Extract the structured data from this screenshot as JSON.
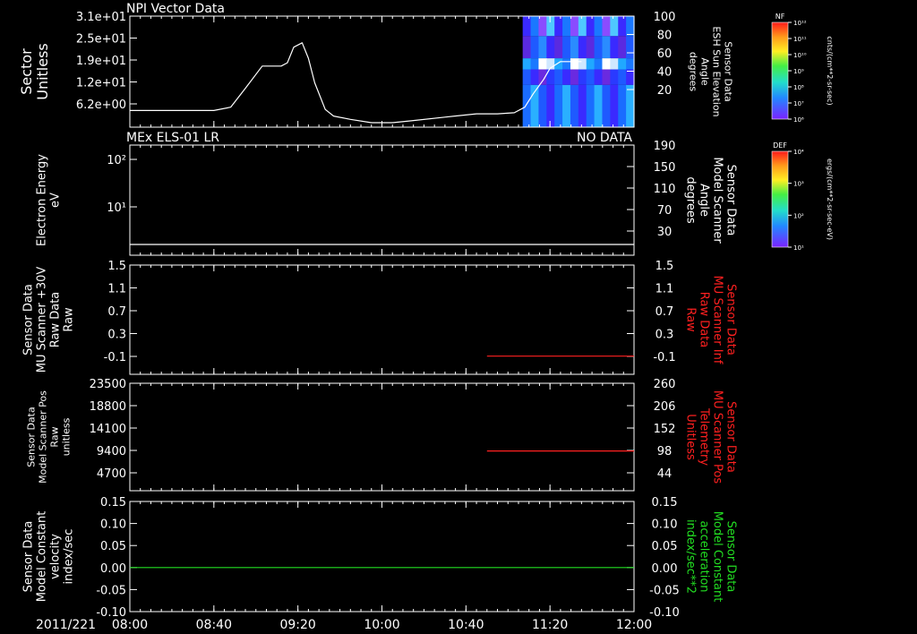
{
  "colors": {
    "background": "#000000",
    "axis": "#ffffff",
    "red_trace": "#ff2020",
    "green_trace": "#22dd22"
  },
  "chart_data": [
    {
      "panel": "npi-vector",
      "type": "line",
      "title": "NPI Vector Data",
      "right_status": "",
      "ylabel_left": [
        "Sector",
        "Unitless"
      ],
      "ylabel_right": [
        "Sensor Data",
        "ESH Sun Elevation",
        "Angle",
        "degrees"
      ],
      "right_label_color": "#ffffff",
      "yticks_left": [
        "3.1e+01",
        "2.5e+01",
        "1.9e+01",
        "1.2e+01",
        "6.2e+00"
      ],
      "yticks_right": [
        "100",
        "80",
        "60",
        "40",
        "20"
      ],
      "ylim_right": [
        0,
        100
      ],
      "line_color": "#ffffff",
      "x": [
        "08:00",
        "08:10",
        "08:20",
        "08:25",
        "08:30",
        "08:35",
        "08:40",
        "08:48",
        "08:55",
        "09:03",
        "09:12",
        "09:15",
        "09:18",
        "09:22",
        "09:25",
        "09:28",
        "09:33",
        "09:37",
        "09:45",
        "09:55",
        "10:05",
        "10:15",
        "10:30",
        "10:45",
        "10:55",
        "11:03",
        "11:08",
        "11:12",
        "11:17",
        "11:20",
        "11:25",
        "11:30",
        "11:35"
      ],
      "y": [
        15,
        15,
        15,
        15,
        15,
        15,
        15,
        18,
        35,
        55,
        55,
        58,
        72,
        76,
        62,
        40,
        16,
        10,
        7,
        4,
        4,
        6,
        9,
        12,
        12,
        13,
        18,
        30,
        43,
        53,
        59,
        59,
        59
      ],
      "spectrogram": {
        "x_start": "11:07",
        "x_end": "11:35",
        "bands": [
          {
            "from": 82,
            "to": 100,
            "colors": [
              "#3a2aff",
              "#1a78ff",
              "#8a4cff",
              "#4fc8ff"
            ]
          },
          {
            "from": 62,
            "to": 82,
            "colors": [
              "#3a2aff",
              "#5a2ae0",
              "#1f5aff",
              "#2a8cff"
            ]
          },
          {
            "from": 52,
            "to": 62,
            "colors": [
              "#ffffff",
              "#cfe8ff",
              "#20a8ff",
              "#1a78ff"
            ]
          },
          {
            "from": 38,
            "to": 52,
            "colors": [
              "#3a2aff",
              "#6a2ae0",
              "#2a3aff",
              "#1f5aff"
            ]
          },
          {
            "from": 0,
            "to": 38,
            "colors": [
              "#1a6cff",
              "#2ab0ff",
              "#1f5aff",
              "#3a2aff"
            ]
          }
        ]
      }
    },
    {
      "panel": "els",
      "type": "line",
      "title": "MEx ELS-01 LR",
      "right_status": "NO DATA",
      "ylabel_left": [
        "Electron Energy",
        "eV"
      ],
      "ylabel_right": [
        "Sensor Data",
        "Model Scanner",
        "Angle",
        "degrees"
      ],
      "right_label_color": "#ffffff",
      "yticks_left": [
        "10²",
        "10¹"
      ],
      "yticks_right": [
        "190",
        "150",
        "110",
        "70",
        "30"
      ],
      "ylim_right": [
        0,
        190
      ],
      "line_color": "#ffffff",
      "x": [
        "08:00",
        "12:00"
      ],
      "y": [
        0,
        0
      ]
    },
    {
      "panel": "scanner-raw",
      "type": "line",
      "title": "",
      "right_status": "",
      "ylabel_left": [
        "Sensor Data",
        "MU Scanner +30V",
        "Raw Data",
        "Raw"
      ],
      "ylabel_right": [
        "Sensor Data",
        "MU Scanner Inf",
        "Raw Data",
        "Raw"
      ],
      "right_label_color": "#ff2020",
      "yticks_left": [
        "1.5",
        "1.1",
        "0.7",
        "0.3",
        "-0.1"
      ],
      "yticks_right": [
        "1.5",
        "1.1",
        "0.7",
        "0.3",
        "-0.1"
      ],
      "ylim": [
        -0.3,
        1.5
      ],
      "line_color": "#ff2020",
      "x": [
        "10:50",
        "12:00"
      ],
      "y": [
        0.0,
        0.0
      ]
    },
    {
      "panel": "scanner-pos",
      "type": "line",
      "title": "",
      "right_status": "",
      "ylabel_left": [
        "Sensor Data",
        "Model Scanner Pos",
        "Raw",
        "unitless"
      ],
      "ylabel_right": [
        "Sensor Data",
        "MU Scanner Pos",
        "Telemetry",
        "Unitless"
      ],
      "right_label_color": "#ff2020",
      "yticks_left": [
        "23500",
        "18800",
        "14100",
        "9400",
        "4700"
      ],
      "yticks_right": [
        "260",
        "206",
        "152",
        "98",
        "44"
      ],
      "ylim": [
        0,
        23500
      ],
      "line_color": "#ff2020",
      "x": [
        "10:50",
        "12:00"
      ],
      "y": [
        8700,
        8700
      ]
    },
    {
      "panel": "constant-velocity",
      "type": "line",
      "title": "",
      "right_status": "",
      "ylabel_left": [
        "Sensor Data",
        "Model Constant",
        "velocity",
        "index/sec"
      ],
      "ylabel_right": [
        "Sensor Data",
        "Model Constant",
        "acceleration",
        "index/sec**2"
      ],
      "right_label_color": "#22dd22",
      "yticks_left": [
        "0.15",
        "0.10",
        "0.05",
        "0.00",
        "-0.05",
        "-0.10"
      ],
      "yticks_right": [
        "0.15",
        "0.10",
        "0.05",
        "0.00",
        "-0.05",
        "-0.10"
      ],
      "ylim": [
        -0.1,
        0.15
      ],
      "line_color": "#22dd22",
      "x": [
        "08:00",
        "12:00"
      ],
      "y": [
        0.0,
        0.0
      ]
    }
  ],
  "x_axis": {
    "date": "2011/221",
    "ticks": [
      "08:00",
      "08:40",
      "09:20",
      "10:00",
      "10:40",
      "11:20",
      "12:00"
    ],
    "range": [
      "08:00",
      "12:00"
    ]
  },
  "colorbars": [
    {
      "name": "nf",
      "label": "NF",
      "unit": "cnts/(cm**2-sr-sec)",
      "ticks": [
        "10¹²",
        "10¹¹",
        "10¹⁰",
        "10⁹",
        "10⁸",
        "10⁷",
        "10⁶"
      ]
    },
    {
      "name": "def",
      "label": "DEF",
      "unit": "ergs/(cm**2-sr-sec-eV)",
      "ticks": [
        "10⁴",
        "10³",
        "10²",
        "10¹"
      ]
    }
  ]
}
